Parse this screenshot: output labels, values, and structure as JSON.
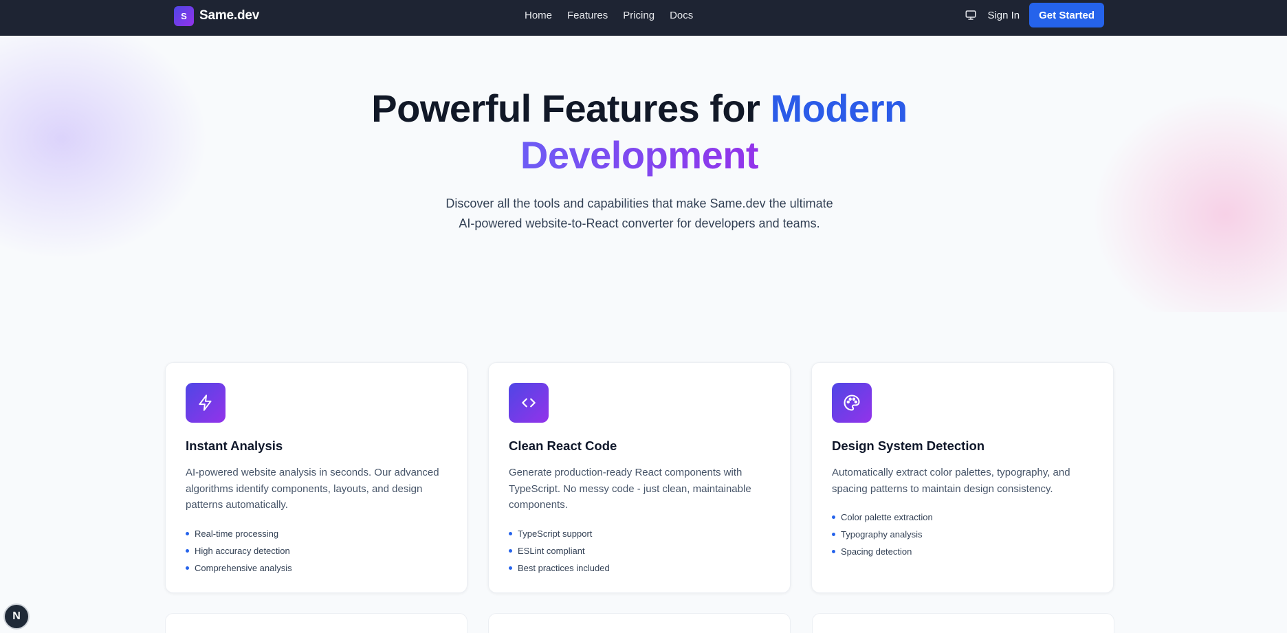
{
  "nav": {
    "brand_initial": "S",
    "brand_name": "Same.dev",
    "links": [
      "Home",
      "Features",
      "Pricing",
      "Docs"
    ],
    "sign_in": "Sign In",
    "get_started": "Get Started",
    "theme_icon": "monitor-icon"
  },
  "hero": {
    "title_part1": "Powerful Features for ",
    "title_part2": "Modern",
    "title_part3": "Development",
    "subtitle_line1": "Discover all the tools and capabilities that make Same.dev the ultimate",
    "subtitle_line2": "AI-powered website-to-React converter for developers and teams."
  },
  "cards": [
    {
      "icon": "lightning-icon",
      "title": "Instant Analysis",
      "description": "AI-powered website analysis in seconds. Our advanced algorithms identify components, layouts, and design patterns automatically.",
      "features": [
        "Real-time processing",
        "High accuracy detection",
        "Comprehensive analysis"
      ]
    },
    {
      "icon": "code-icon",
      "title": "Clean React Code",
      "description": "Generate production-ready React components with TypeScript. No messy code - just clean, maintainable components.",
      "features": [
        "TypeScript support",
        "ESLint compliant",
        "Best practices included"
      ]
    },
    {
      "icon": "palette-icon",
      "title": "Design System Detection",
      "description": "Automatically extract color palettes, typography, and spacing patterns to maintain design consistency.",
      "features": [
        "Color palette extraction",
        "Typography analysis",
        "Spacing detection"
      ]
    }
  ],
  "badge": {
    "letter": "N"
  },
  "colors": {
    "nav_bg": "#1e2433",
    "accent_blue": "#2563eb",
    "accent_purple": "#9333ea"
  }
}
